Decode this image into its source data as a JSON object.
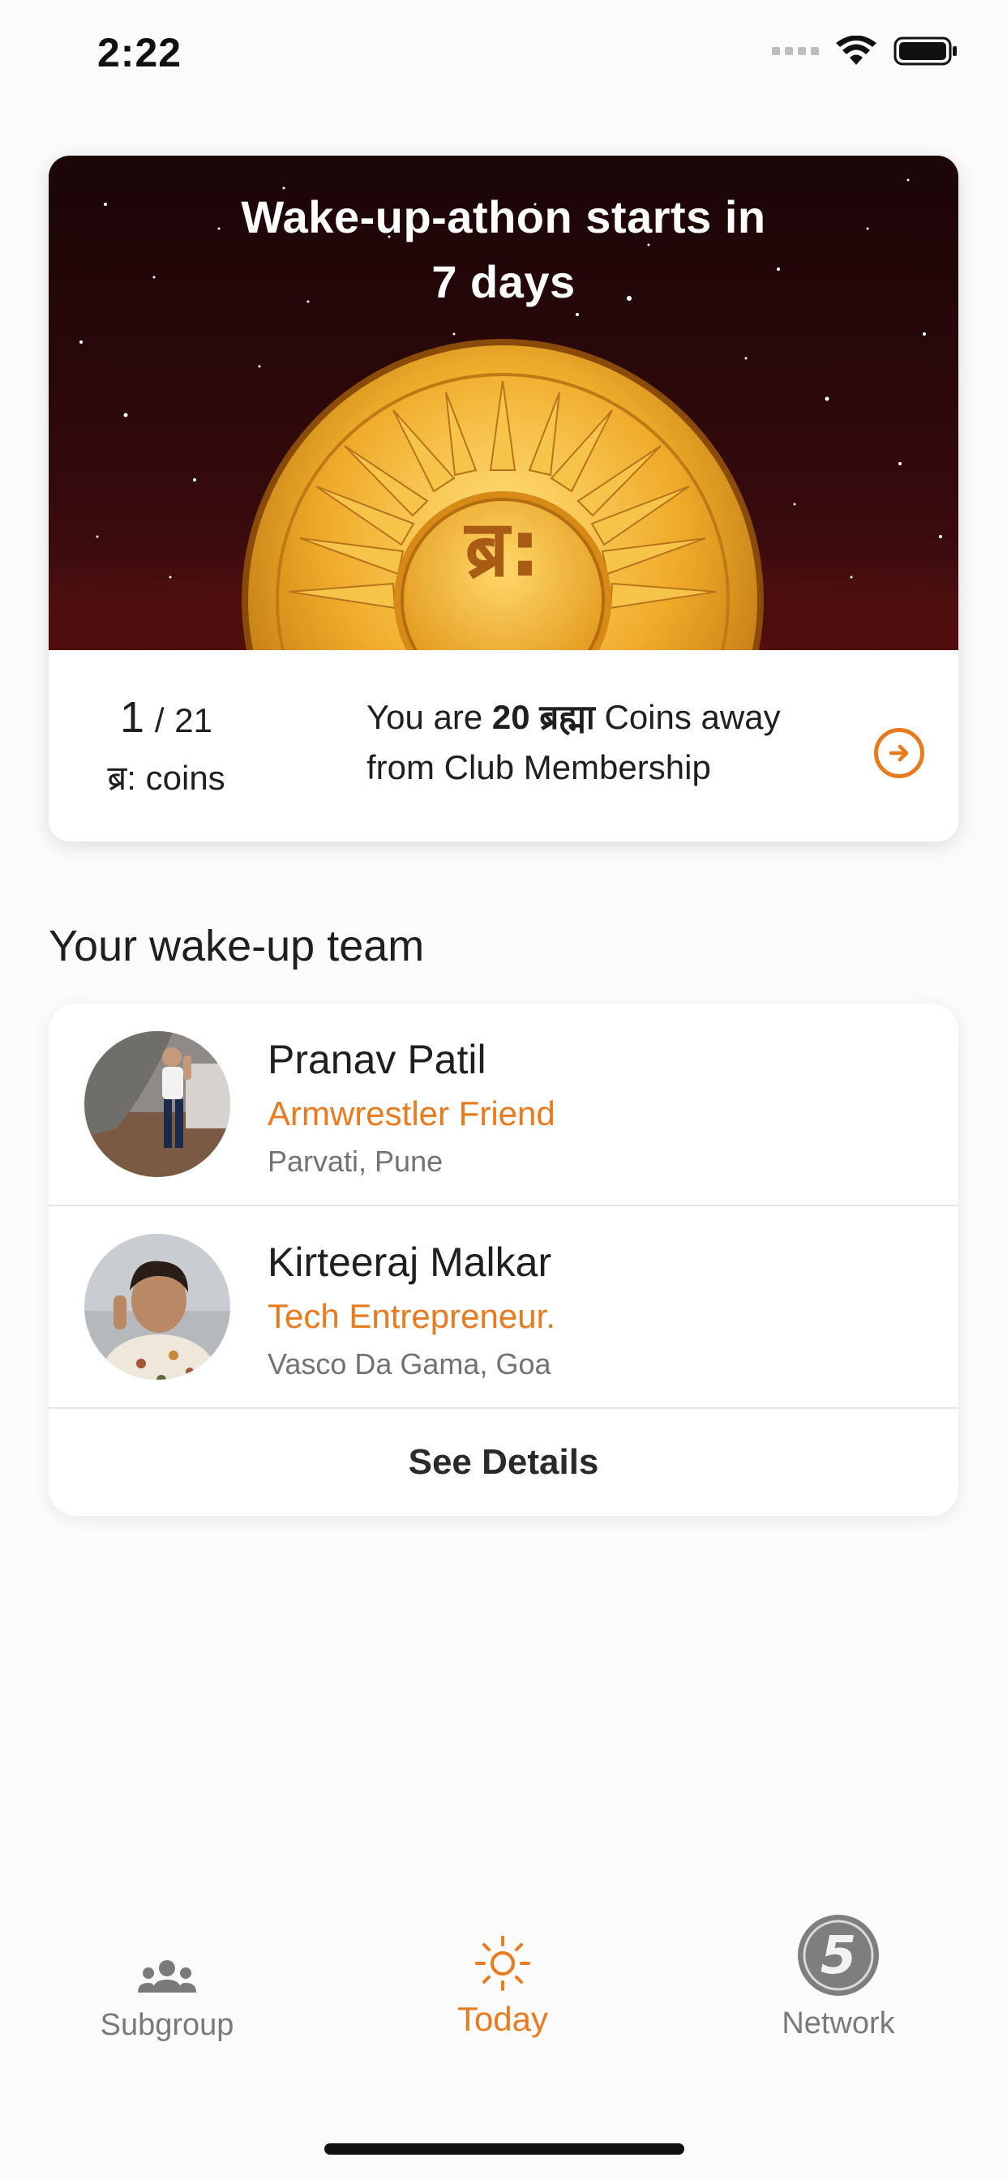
{
  "status_bar": {
    "time": "2:22"
  },
  "coin_card": {
    "title_line1": "Wake-up-athon starts in",
    "title_line2": "7 days",
    "coin_symbol": "ब्र:",
    "coins_earned": "1",
    "coins_separator": "/",
    "coins_total": "21",
    "coins_unit": "ब्र: coins",
    "message_prefix": "You are",
    "message_amount": "20 ब्रह्मा",
    "message_suffix": "Coins away",
    "message_line2": "from Club Membership"
  },
  "team": {
    "heading": "Your wake-up team",
    "members": [
      {
        "name": "Pranav Patil",
        "tag": "Armwrestler Friend",
        "location": "Parvati, Pune"
      },
      {
        "name": "Kirteeraj Malkar",
        "tag": "Tech Entrepreneur.",
        "location": "Vasco Da Gama, Goa"
      }
    ],
    "see_details": "See Details"
  },
  "bottom_nav": {
    "items": [
      {
        "label": "Subgroup",
        "icon": "group-icon",
        "active": false
      },
      {
        "label": "Today",
        "icon": "sun-icon",
        "active": true
      },
      {
        "label": "Network",
        "icon": "five-badge-icon",
        "active": false
      }
    ],
    "network_badge": "5"
  },
  "colors": {
    "accent": "#ea7a1e",
    "hero_dark": "#1b0607",
    "hero_red": "#5a1214",
    "coin_gold": "#f2b42e"
  }
}
